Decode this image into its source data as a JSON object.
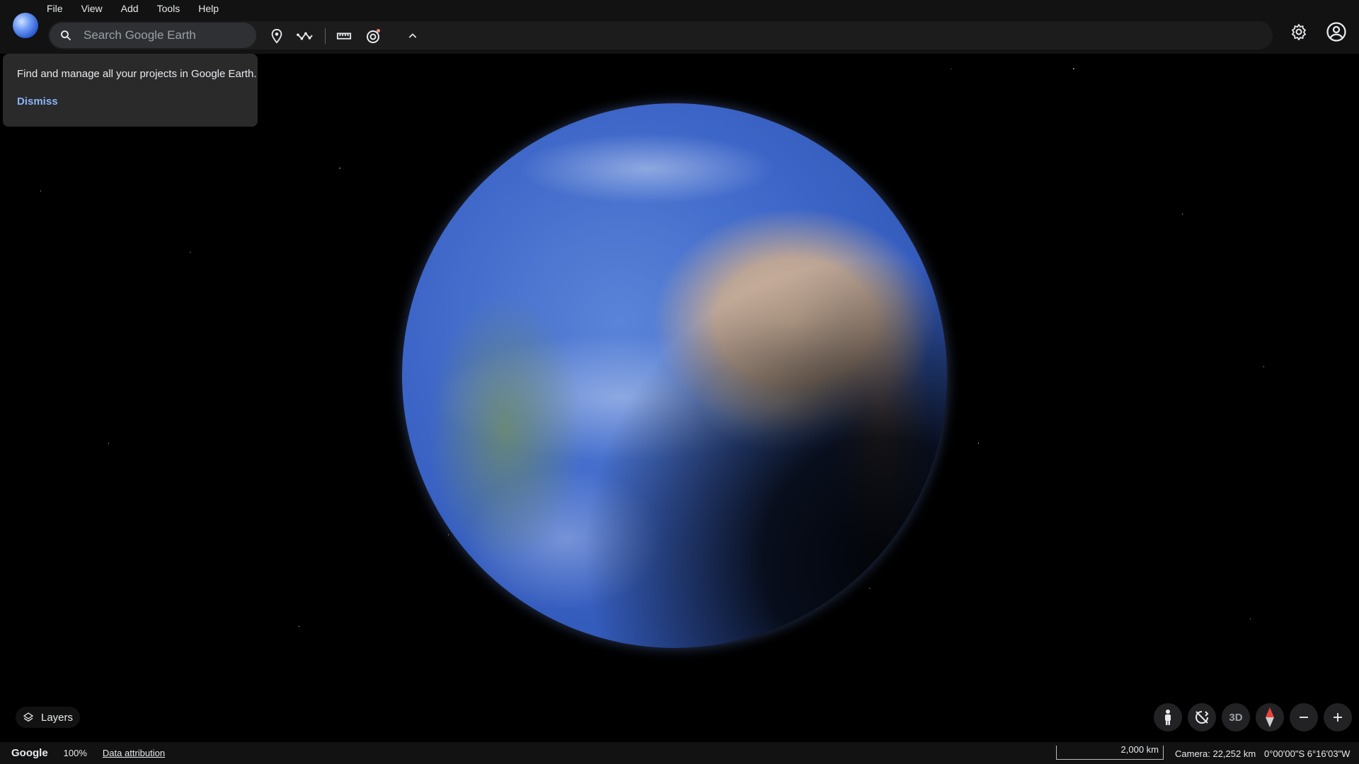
{
  "menu": {
    "items": [
      "File",
      "View",
      "Add",
      "Tools",
      "Help"
    ]
  },
  "search": {
    "placeholder": "Search Google Earth"
  },
  "toolbar": {
    "icons": [
      "placemark-icon",
      "path-icon",
      "ruler-icon",
      "timelapse-icon",
      "chevron-up-icon"
    ],
    "right_icons": [
      "settings-icon",
      "account-icon"
    ]
  },
  "popup": {
    "text": "Find and manage all your projects in Google Earth.",
    "dismiss": "Dismiss"
  },
  "layers": {
    "label": "Layers"
  },
  "nav": {
    "view_mode": "3D"
  },
  "status": {
    "brand": "Google",
    "zoom": "100%",
    "attribution": "Data attribution",
    "scale": "2,000 km",
    "camera": "Camera: 22,252 km",
    "coords": "0°00'00\"S 6°16'03\"W"
  },
  "colors": {
    "accent": "#8ab4f8",
    "bar_bg": "#121212",
    "search_bg": "#2f3033",
    "popup_bg": "#2a2a2b"
  }
}
